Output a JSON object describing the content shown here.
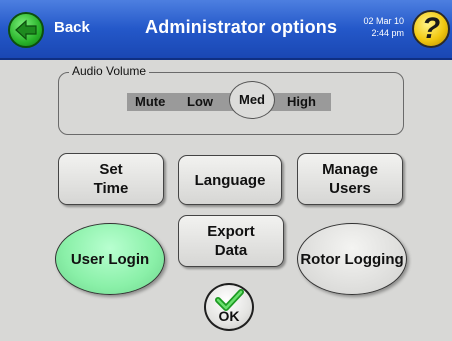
{
  "header": {
    "back_label": "Back",
    "title": "Administrator options",
    "date": "02 Mar 10",
    "time": "2:44 pm",
    "help_symbol": "?"
  },
  "audio_volume": {
    "legend": "Audio Volume",
    "options": [
      "Mute",
      "Low",
      "Med",
      "High"
    ],
    "selected": "Med"
  },
  "buttons": {
    "set_time": [
      "Set",
      "Time"
    ],
    "language": "Language",
    "manage_users": [
      "Manage",
      "Users"
    ],
    "user_login": [
      "User",
      "Login"
    ],
    "export_data": [
      "Export",
      "Data"
    ],
    "rotor_logging": [
      "Rotor",
      "Logging"
    ],
    "ok": "OK"
  },
  "colors": {
    "header": "#2458c9",
    "background": "#d8d8d6",
    "user_login_green": "#8af0a8",
    "back_green": "#29b32a",
    "help_yellow": "#f2c810"
  },
  "icons": [
    "back-arrow-icon",
    "help-icon",
    "check-icon"
  ]
}
